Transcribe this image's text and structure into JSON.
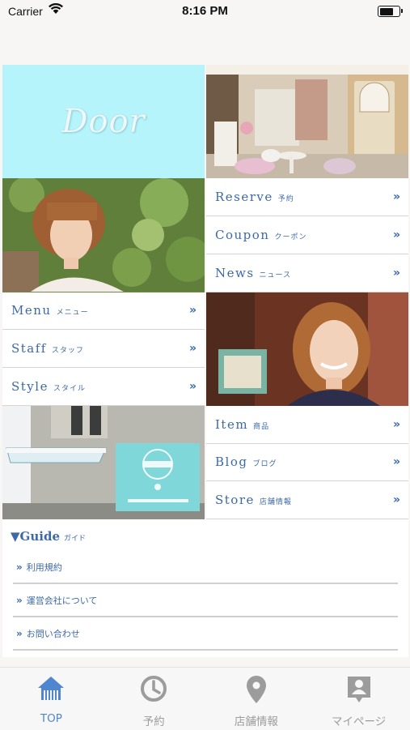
{
  "status_bar": {
    "carrier": "Carrier",
    "time": "8:16 PM"
  },
  "logo": {
    "text": "Door"
  },
  "menu_left": [
    {
      "en": "Menu",
      "jp": "メニュー",
      "arrow": "»"
    },
    {
      "en": "Staff",
      "jp": "スタッフ",
      "arrow": "»"
    },
    {
      "en": "Style",
      "jp": "スタイル",
      "arrow": "»"
    }
  ],
  "menu_right_top": [
    {
      "en": "Reserve",
      "jp": "予約",
      "arrow": "»"
    },
    {
      "en": "Coupon",
      "jp": "クーポン",
      "arrow": "»"
    },
    {
      "en": "News",
      "jp": "ニュース",
      "arrow": "»"
    }
  ],
  "menu_right_bottom": [
    {
      "en": "Item",
      "jp": "商品",
      "arrow": "»"
    },
    {
      "en": "Blog",
      "jp": "ブログ",
      "arrow": "»"
    },
    {
      "en": "Store",
      "jp": "店舗情報",
      "arrow": "»"
    }
  ],
  "guide": {
    "title": "▼Guide",
    "title_jp": "ガイド",
    "chevron": "»",
    "items": [
      "利用規約",
      "運営会社について",
      "お問い合わせ"
    ]
  },
  "tabs": [
    {
      "label": "TOP",
      "icon": "home-icon",
      "active": true
    },
    {
      "label": "予約",
      "icon": "clock-icon",
      "active": false
    },
    {
      "label": "店舗情報",
      "icon": "map-pin-icon",
      "active": false
    },
    {
      "label": "マイページ",
      "icon": "person-badge-icon",
      "active": false
    }
  ],
  "colors": {
    "accent": "#3c69a8",
    "tab_active": "#4f86cf",
    "logo_bg": "#b5f4fa",
    "tab_inactive": "#9c9c9c"
  }
}
